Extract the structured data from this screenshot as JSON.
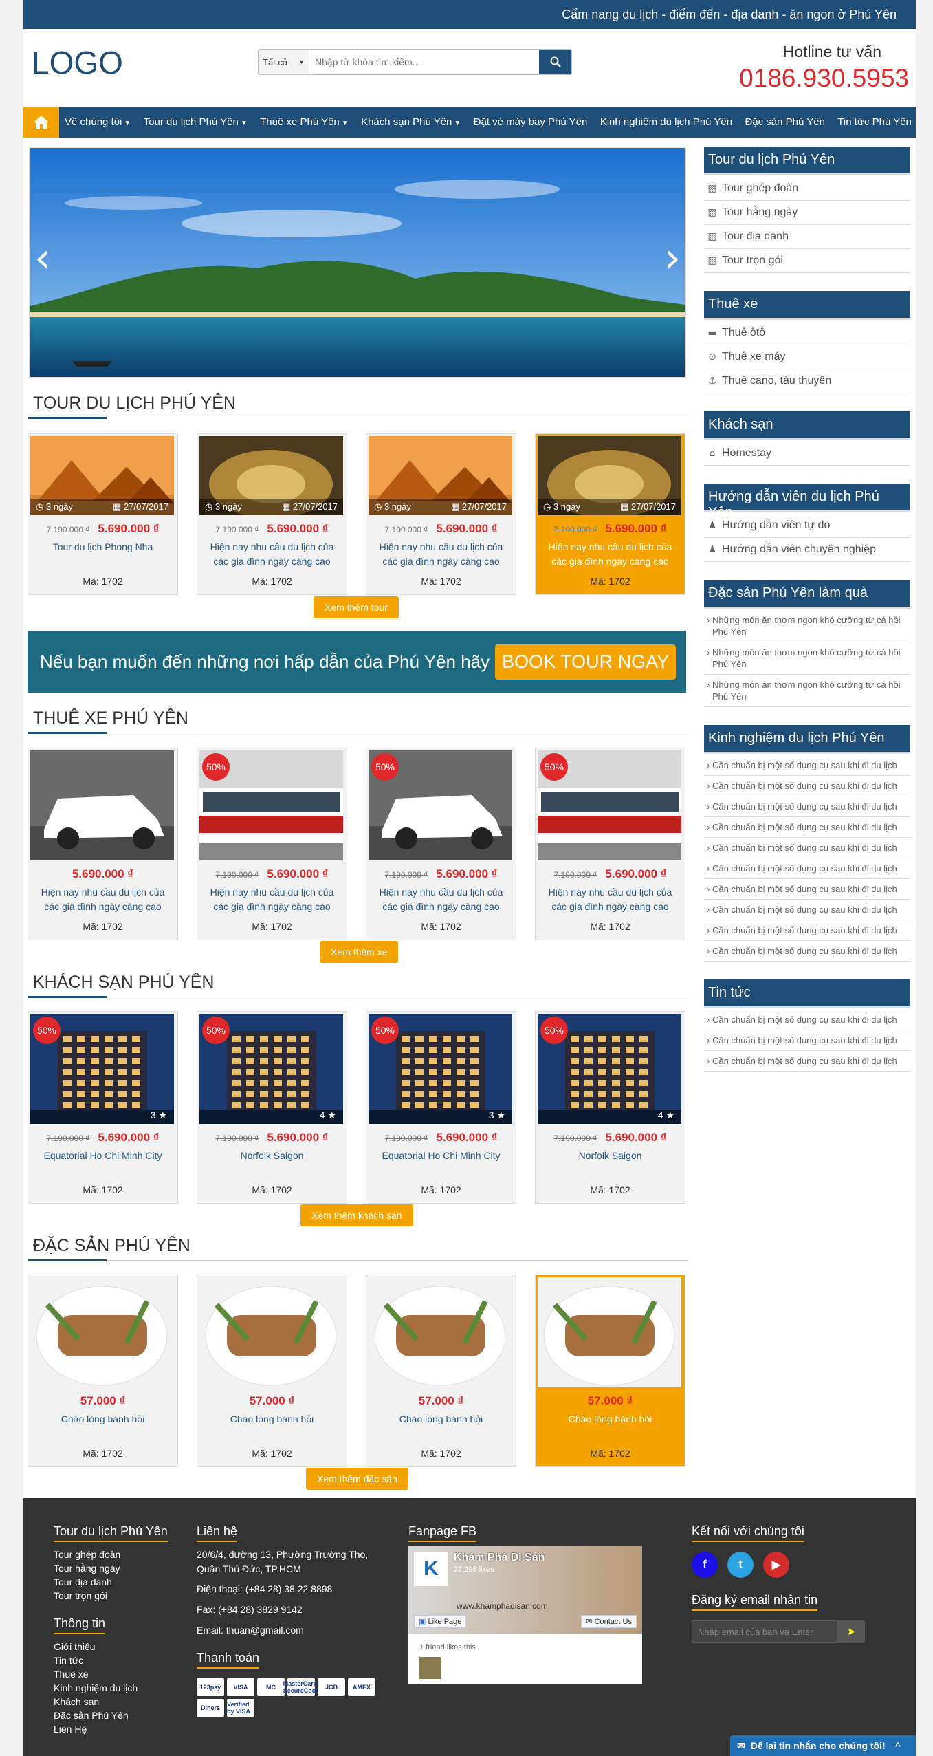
{
  "topbar": {
    "text": "Cẩm nang du lịch - điểm đến - địa danh - ăn ngon ở Phú Yên"
  },
  "header": {
    "logo": "LOGO",
    "search_category": "Tất cả",
    "search_placeholder": "Nhập từ khóa tìm kiếm...",
    "hotline_label": "Hotline tư vấn",
    "hotline_number": "0186.930.5953"
  },
  "nav": {
    "items": [
      {
        "label": "Về chúng tôi",
        "dropdown": true
      },
      {
        "label": "Tour du lịch Phú Yên",
        "dropdown": true
      },
      {
        "label": "Thuê xe Phú Yên",
        "dropdown": true
      },
      {
        "label": "Khách sạn Phú Yên",
        "dropdown": true
      },
      {
        "label": "Đặt vé máy bay Phú Yên"
      },
      {
        "label": "Kinh nghiệm du lịch Phú Yên"
      },
      {
        "label": "Đặc sản Phú Yên"
      },
      {
        "label": "Tin tức Phú Yên"
      }
    ]
  },
  "sections": {
    "tour": {
      "title": "TOUR DU LỊCH PHÚ YÊN",
      "more": "Xem thêm tour",
      "cards": [
        {
          "days": "3 ngày",
          "date": "27/07/2017",
          "old": "7.190.000 ₫",
          "new": "5.690.000 ₫",
          "name": "Tour du lịch Phong Nha",
          "code": "Mã: 1702"
        },
        {
          "days": "3 ngày",
          "date": "27/07/2017",
          "old": "7.190.000 ₫",
          "new": "5.690.000 ₫",
          "name": "Hiện nay nhu cầu du lịch của các gia đình ngày càng cao",
          "code": "Mã: 1702"
        },
        {
          "days": "3 ngày",
          "date": "27/07/2017",
          "old": "7.190.000 ₫",
          "new": "5.690.000 ₫",
          "name": "Hiện nay nhu cầu du lịch của các gia đình ngày càng cao",
          "code": "Mã: 1702"
        },
        {
          "days": "3 ngày",
          "date": "27/07/2017",
          "old": "7.190.000 ₫",
          "new": "5.690.000 ₫",
          "name": "Hiện nay nhu cầu du lịch của các gia đình ngày càng cao",
          "code": "Mã: 1702"
        }
      ]
    },
    "banner": {
      "text": "Nếu bạn muốn đến những nơi hấp dẫn của Phú Yên hãy",
      "button": "BOOK TOUR NGAY"
    },
    "car": {
      "title": "THUÊ XE PHÚ YÊN",
      "more": "Xem thêm xe",
      "cards": [
        {
          "badge": "",
          "old": "",
          "new": "5.690.000 ₫",
          "name": "Hiện nay nhu cầu du lịch của các gia đình ngày càng cao",
          "code": "Mã: 1702"
        },
        {
          "badge": "50%",
          "old": "7.190.000 ₫",
          "new": "5.690.000 ₫",
          "name": "Hiện nay nhu cầu du lịch của các gia đình ngày càng cao",
          "code": "Mã: 1702"
        },
        {
          "badge": "50%",
          "old": "7.190.000 ₫",
          "new": "5.690.000 ₫",
          "name": "Hiện nay nhu cầu du lịch của các gia đình ngày càng cao",
          "code": "Mã: 1702"
        },
        {
          "badge": "50%",
          "old": "7.190.000 ₫",
          "new": "5.690.000 ₫",
          "name": "Hiện nay nhu cầu du lịch của các gia đình ngày càng cao",
          "code": "Mã: 1702"
        }
      ]
    },
    "hotel": {
      "title": "KHÁCH SẠN PHÚ YÊN",
      "more": "Xem thêm khách sạn",
      "cards": [
        {
          "badge": "50%",
          "stars": "3 ★",
          "old": "7.190.000 ₫",
          "new": "5.690.000 ₫",
          "name": "Equatorial Ho Chi Minh City",
          "code": "Mã: 1702"
        },
        {
          "badge": "50%",
          "stars": "4 ★",
          "old": "7.190.000 ₫",
          "new": "5.690.000 ₫",
          "name": "Norfolk Saigon",
          "code": "Mã: 1702"
        },
        {
          "badge": "50%",
          "stars": "3 ★",
          "old": "7.190.000 ₫",
          "new": "5.690.000 ₫",
          "name": "Equatorial Ho Chi Minh City",
          "code": "Mã: 1702"
        },
        {
          "badge": "50%",
          "stars": "4 ★",
          "old": "7.190.000 ₫",
          "new": "5.690.000 ₫",
          "name": "Norfolk Saigon",
          "code": "Mã: 1702"
        }
      ]
    },
    "food": {
      "title": "ĐẶC SẢN PHÚ YÊN",
      "more": "Xem thêm đặc sản",
      "cards": [
        {
          "new": "57.000 ₫",
          "name": "Cháo lòng bánh hỏi",
          "code": "Mã: 1702"
        },
        {
          "new": "57.000 ₫",
          "name": "Cháo lòng bánh hỏi",
          "code": "Mã: 1702"
        },
        {
          "new": "57.000 ₫",
          "name": "Cháo lòng bánh hỏi",
          "code": "Mã: 1702"
        },
        {
          "new": "57.000 ₫",
          "name": "Cháo lòng bánh hỏi",
          "code": "Mã: 1702"
        }
      ]
    }
  },
  "sidebar": {
    "tour": {
      "title": "Tour du lịch Phú Yên",
      "items": [
        "Tour ghép đoàn",
        "Tour hằng ngày",
        "Tour địa danh",
        "Tour trọn gói"
      ]
    },
    "car": {
      "title": "Thuê xe",
      "items": [
        "Thuê ôtô",
        "Thuê xe máy",
        "Thuê cano, tàu thuyền"
      ]
    },
    "hotel": {
      "title": "Khách sạn",
      "items": [
        "Homestay"
      ]
    },
    "guide": {
      "title": "Hướng dẫn viên du lịch Phú Yên",
      "items": [
        "Hướng dẫn viên tự do",
        "Hướng dẫn viên chuyên nghiệp"
      ]
    },
    "gift": {
      "title": "Đặc sản Phú Yên làm quà",
      "items": [
        "Những món ăn thơm ngon khó cưỡng từ cá hồi Phú Yên",
        "Những món ăn thơm ngon khó cưỡng từ cá hồi Phú Yên",
        "Những món ăn thơm ngon khó cưỡng từ cá hồi Phú Yên"
      ]
    },
    "exp": {
      "title": "Kinh nghiệm du lịch Phú Yên",
      "items": [
        "Cần chuẩn bị một số dụng cụ sau khi đi du lịch",
        "Cần chuẩn bị một số dụng cụ sau khi đi du lịch",
        "Cần chuẩn bị một số dụng cụ sau khi đi du lịch",
        "Cần chuẩn bị một số dụng cụ sau khi đi du lịch",
        "Cần chuẩn bị một số dụng cụ sau khi đi du lịch",
        "Cần chuẩn bị một số dụng cụ sau khi đi du lịch",
        "Cần chuẩn bị một số dụng cụ sau khi đi du lịch",
        "Cần chuẩn bị một số dụng cụ sau khi đi du lịch",
        "Cần chuẩn bị một số dụng cụ sau khi đi du lịch",
        "Cần chuẩn bị một số dụng cụ sau khi đi du lịch"
      ]
    },
    "news": {
      "title": "Tin tức",
      "items": [
        "Cần chuẩn bị một số dụng cụ sau khi đi du lịch",
        "Cần chuẩn bị một số dụng cụ sau khi đi du lịch",
        "Cần chuẩn bị một số dụng cụ sau khi đi du lịch"
      ]
    }
  },
  "footer": {
    "col1": {
      "title": "Tour du lịch Phú Yên",
      "items": [
        "Tour ghép đoàn",
        "Tour hằng ngày",
        "Tour địa danh",
        "Tour trọn gói"
      ]
    },
    "col1b": {
      "title": "Thông tin",
      "items": [
        "Giới thiệu",
        "Tin tức",
        "Thuê xe",
        "Kinh nghiệm du lịch",
        "Khách sạn",
        "Đặc sản Phú Yên",
        "Liên Hệ"
      ]
    },
    "contact": {
      "title": "Liên hệ",
      "address": "20/6/4, đường 13, Phường Trường Thọ, Quận Thủ Đức, TP.HCM",
      "phone": "Điện thoại: (+84 28) 38 22 8898",
      "fax": "Fax: (+84 28) 3829 9142",
      "email": "Email: thuan@gmail.com"
    },
    "payment": {
      "title": "Thanh toán",
      "logos": [
        "123pay",
        "VISA",
        "MC",
        "MasterCard SecureCode",
        "JCB",
        "AMEX",
        "Diners",
        "Verified by VISA"
      ]
    },
    "fanpage": {
      "title": "Fanpage FB",
      "name": "Khám Phá Di Sản",
      "likes": "27,296 likes",
      "like_btn": "Like Page",
      "contact_btn": "Contact Us",
      "url": "www.khamphadisan.com",
      "friends": "1 friend likes this"
    },
    "social": {
      "title": "Kết nối với chúng tôi",
      "icons": [
        "f",
        "t",
        "▶"
      ]
    },
    "newsletter": {
      "title": "Đăng ký email nhận tin",
      "placeholder": "Nhập email của bạn và Enter"
    },
    "chat": "Để lại tin nhắn cho chúng tôi!"
  }
}
